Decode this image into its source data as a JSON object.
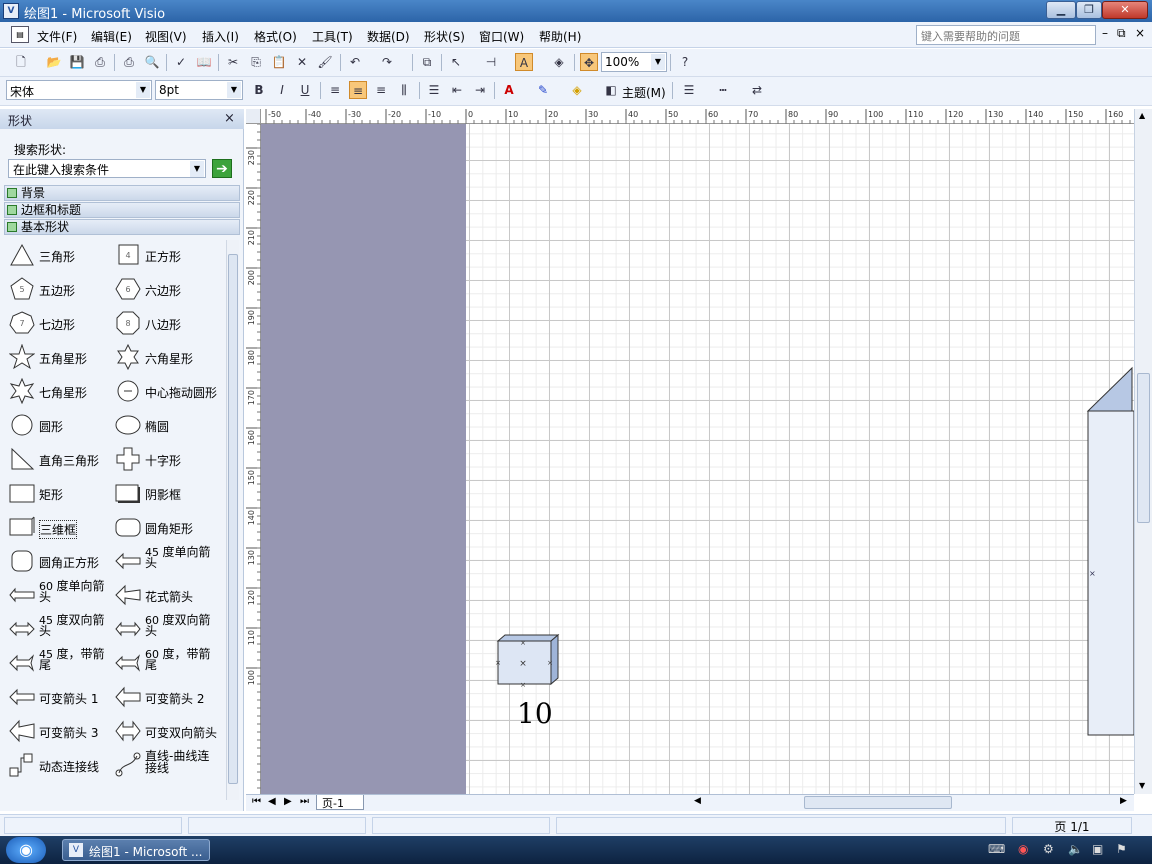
{
  "window": {
    "title": "绘图1 - Microsoft Visio",
    "minimize": "▁",
    "restore": "❐",
    "close": "✕"
  },
  "menu": {
    "items": [
      "文件(F)",
      "编辑(E)",
      "视图(V)",
      "插入(I)",
      "格式(O)",
      "工具(T)",
      "数据(D)",
      "形状(S)",
      "窗口(W)",
      "帮助(H)"
    ],
    "help_placeholder": "键入需要帮助的问题"
  },
  "toolbar": {
    "zoom": "100%",
    "font": "宋体",
    "font_size": "8pt",
    "theme_label": "主题(M)"
  },
  "shapes_panel": {
    "title": "形状",
    "close": "×",
    "search_label": "搜索形状:",
    "search_placeholder": "在此键入搜索条件",
    "stencils": [
      "背景",
      "边框和标题",
      "基本形状"
    ],
    "shapes": [
      {
        "label": "三角形",
        "icon": "triangle-icon"
      },
      {
        "label": "正方形",
        "icon": "square-icon",
        "num": "4"
      },
      {
        "label": "五边形",
        "icon": "pentagon-icon",
        "num": "5"
      },
      {
        "label": "六边形",
        "icon": "hexagon-icon",
        "num": "6"
      },
      {
        "label": "七边形",
        "icon": "heptagon-icon",
        "num": "7"
      },
      {
        "label": "八边形",
        "icon": "octagon-icon",
        "num": "8"
      },
      {
        "label": "五角星形",
        "icon": "star5-icon"
      },
      {
        "label": "六角星形",
        "icon": "star6-icon"
      },
      {
        "label": "七角星形",
        "icon": "star7-icon"
      },
      {
        "label": "中心拖动圆形",
        "icon": "center-circle-icon"
      },
      {
        "label": "圆形",
        "icon": "circle-icon"
      },
      {
        "label": "椭圆",
        "icon": "ellipse-icon"
      },
      {
        "label": "直角三角形",
        "icon": "right-triangle-icon"
      },
      {
        "label": "十字形",
        "icon": "cross-icon"
      },
      {
        "label": "矩形",
        "icon": "rectangle-icon"
      },
      {
        "label": "阴影框",
        "icon": "shadow-box-icon"
      },
      {
        "label": "三维框",
        "icon": "3d-box-icon"
      },
      {
        "label": "圆角矩形",
        "icon": "rounded-rect-icon"
      },
      {
        "label": "圆角正方形",
        "icon": "rounded-square-icon"
      },
      {
        "label": "度单向箭头",
        "pre": "45",
        "icon": "arrow45-icon"
      },
      {
        "label": "度单向箭头",
        "pre": "60",
        "icon": "arrow60-icon"
      },
      {
        "label": "花式箭头",
        "icon": "fancy-arrow-icon"
      },
      {
        "label": "度双向箭头",
        "pre": "45",
        "icon": "double-arrow45-icon"
      },
      {
        "label": "度双向箭头",
        "pre": "60",
        "icon": "double-arrow60-icon"
      },
      {
        "label": "度，带箭尾",
        "pre": "45",
        "icon": "tail-arrow45-icon"
      },
      {
        "label": "度，带箭尾",
        "pre": "60",
        "icon": "tail-arrow60-icon"
      },
      {
        "label": "可变箭头 1",
        "icon": "variable-arrow1-icon"
      },
      {
        "label": "可变箭头 2",
        "icon": "variable-arrow2-icon"
      },
      {
        "label": "可变箭头 3",
        "icon": "variable-arrow3-icon"
      },
      {
        "label": "可变双向箭头",
        "icon": "variable-double-arrow-icon"
      },
      {
        "label": "动态连接线",
        "icon": "dynamic-connector-icon"
      },
      {
        "label": "直线-曲线连接线",
        "icon": "line-curve-connector-icon"
      }
    ]
  },
  "ruler": {
    "top": [
      "-50",
      "-40",
      "-30",
      "-20",
      "-10",
      "0",
      "10",
      "20",
      "30",
      "40",
      "50",
      "60",
      "70",
      "80",
      "90",
      "100",
      "110",
      "120",
      "130",
      "140",
      "150",
      "160"
    ],
    "left": [
      "230",
      "220",
      "210",
      "200",
      "190",
      "180",
      "170",
      "160",
      "150",
      "140",
      "130",
      "120",
      "110",
      "100"
    ]
  },
  "canvas": {
    "box_label": "10"
  },
  "pagetabs": {
    "tab": "页-1"
  },
  "status": {
    "page": "页 1/1"
  },
  "taskbar": {
    "start": "◉",
    "task": "绘图1 - Microsoft ..."
  }
}
